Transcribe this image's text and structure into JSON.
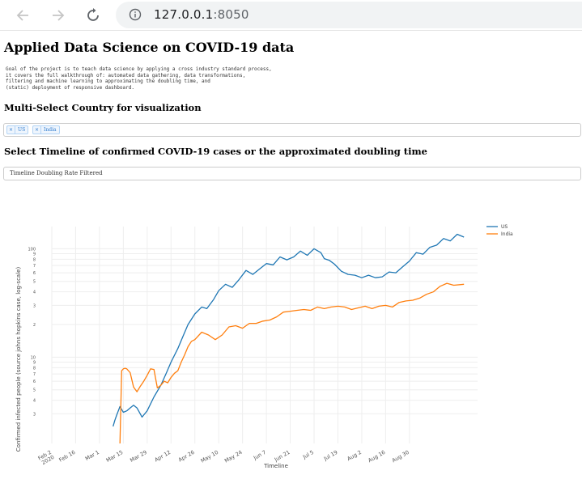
{
  "browser": {
    "url_host": "127.0.0.1",
    "url_port": ":8050",
    "back_icon": "arrow-left-icon",
    "forward_icon": "arrow-right-icon",
    "reload_icon": "reload-icon",
    "info_icon": "info-icon"
  },
  "page": {
    "title": "Applied Data Science on COVID-19 data",
    "description": "Goal of the project is to teach data science by applying a cross industry standard process,\nit covers the full walkthrough of: automated data gathering, data transformations,\nfiltering and machine learning to approximating the doubling time, and\n(static) deployment of responsive dashboard.",
    "country_heading": "Multi-Select Country for visualization",
    "country_selected": [
      "US",
      "India"
    ],
    "remove_glyph": "×",
    "timeline_heading": "Select Timeline of confirmed COVID-19 cases or the approximated doubling time",
    "timeline_value": "Timeline Doubling Rate Filtered"
  },
  "colors": {
    "us": "#1f77b4",
    "india": "#ff7f0e",
    "tag_text": "#2e7bcf"
  },
  "chart_data": {
    "type": "line",
    "xlabel": "Timeline",
    "ylabel": "Confirmed infected people (source johns hopkins case, log-scale)",
    "yscale": "log",
    "ylim": [
      1.6,
      160
    ],
    "x_ticks": [
      "Feb 2\n2020",
      "Feb 16",
      "Mar 1",
      "Mar 15",
      "Mar 29",
      "Apr 12",
      "Apr 26",
      "May 10",
      "May 24",
      "Jun 7",
      "Jun 21",
      "Jul 5",
      "Jul 19",
      "Aug 2",
      "Aug 16",
      "Aug 30"
    ],
    "y_ticks": [
      {
        "v": 3,
        "label": "3"
      },
      {
        "v": 4,
        "label": "4"
      },
      {
        "v": 5,
        "label": "5"
      },
      {
        "v": 6,
        "label": "6"
      },
      {
        "v": 7,
        "label": "7"
      },
      {
        "v": 8,
        "label": "8"
      },
      {
        "v": 9,
        "label": "9"
      },
      {
        "v": 10,
        "label": "10"
      },
      {
        "v": 20,
        "label": "2"
      },
      {
        "v": 30,
        "label": "3"
      },
      {
        "v": 40,
        "label": "4"
      },
      {
        "v": 50,
        "label": "5"
      },
      {
        "v": 60,
        "label": "6"
      },
      {
        "v": 70,
        "label": "7"
      },
      {
        "v": 80,
        "label": "8"
      },
      {
        "v": 90,
        "label": "9"
      },
      {
        "v": 100,
        "label": "100"
      }
    ],
    "legend_position": "top-right",
    "grid": true,
    "series": [
      {
        "name": "US",
        "x": [
          36,
          37,
          38,
          40,
          42,
          44,
          46,
          48,
          50,
          53,
          56,
          60,
          64,
          67,
          70,
          74,
          77,
          80,
          84,
          88,
          91,
          95,
          98,
          102,
          106,
          110,
          114,
          118,
          122,
          126,
          130,
          134,
          138,
          142,
          146,
          150,
          154,
          158,
          160,
          163,
          166,
          170,
          174,
          178,
          182,
          186,
          190,
          194,
          198,
          202,
          206,
          210,
          214,
          218,
          222,
          226,
          230,
          234,
          238,
          242
        ],
        "y": [
          2.3,
          2.6,
          2.9,
          3.5,
          3.1,
          3.2,
          3.4,
          3.6,
          3.4,
          2.8,
          3.2,
          4.3,
          5.5,
          7.0,
          9.0,
          12,
          15.5,
          20,
          25,
          29,
          28,
          34,
          41,
          47,
          44,
          52,
          63,
          58,
          65,
          73,
          71,
          84,
          79,
          84,
          95,
          87,
          100,
          92,
          81,
          78,
          72,
          62,
          58,
          57,
          54,
          57,
          54,
          55,
          61,
          60,
          68,
          77,
          92,
          89,
          103,
          108,
          124,
          118,
          136,
          128
        ]
      },
      {
        "name": "India",
        "x": [
          40,
          41,
          42,
          43,
          44,
          46,
          48,
          50,
          52,
          54,
          56,
          58,
          60,
          62,
          64,
          66,
          68,
          70,
          72,
          74,
          76,
          78,
          80,
          82,
          84,
          88,
          92,
          96,
          100,
          104,
          108,
          112,
          116,
          120,
          124,
          128,
          132,
          136,
          140,
          144,
          148,
          152,
          156,
          160,
          164,
          168,
          172,
          176,
          180,
          184,
          188,
          192,
          196,
          200,
          204,
          208,
          212,
          216,
          220,
          224,
          228,
          232,
          236,
          242
        ],
        "y": [
          1.6,
          7.5,
          7.8,
          7.9,
          7.8,
          7.2,
          5.3,
          4.8,
          5.4,
          6.0,
          6.8,
          7.8,
          7.7,
          5.2,
          5.5,
          6.0,
          5.8,
          6.5,
          7.1,
          7.5,
          9.0,
          10.5,
          12.5,
          14,
          14.5,
          17,
          16,
          14.5,
          16,
          19,
          19.5,
          18.5,
          20.5,
          20.5,
          21.5,
          22,
          23.5,
          26,
          26.5,
          27,
          27.5,
          27,
          29,
          28,
          29,
          29.5,
          29,
          27.5,
          28.5,
          29.5,
          28,
          29.5,
          30,
          29,
          32,
          33,
          33.5,
          35,
          38,
          40,
          45,
          48,
          46,
          47
        ]
      }
    ]
  }
}
